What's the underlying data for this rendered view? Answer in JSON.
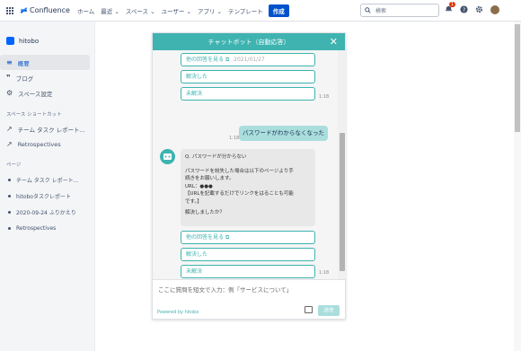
{
  "topbar": {
    "logo_text": "Confluence",
    "nav": [
      "ホーム",
      "最近 ⌄",
      "スペース ⌄",
      "ユーザー ⌄",
      "アプリ ⌄",
      "テンプレート"
    ],
    "create_label": "作成",
    "search_placeholder": "検索",
    "notification_count": "1"
  },
  "sidebar": {
    "space_name": "hitobo",
    "items": [
      {
        "label": "概要",
        "icon": "overview-icon"
      },
      {
        "label": "ブログ",
        "icon": "quote-icon"
      },
      {
        "label": "スペース設定",
        "icon": "gear-icon"
      }
    ],
    "shortcuts_title": "スペース ショートカット",
    "shortcuts": [
      "チーム タスク レポート...",
      "Retrospectives"
    ],
    "pages_title": "ページ",
    "pages": [
      "チーム タスク レポート...",
      "hitoboタスクレポート",
      "2020-09-24 ふりかえり",
      "Retrospectives"
    ]
  },
  "chat": {
    "title": "チャットボット（自動応答）",
    "top_options": [
      "他の回答を見る",
      "解決した",
      "未解決"
    ],
    "top_date": "2021/01/27",
    "time_top": "1:18",
    "user_message": "パスワードがわからなくなった",
    "time_user": "1:18",
    "bot_message": {
      "question": "Q. パスワードが分からない",
      "lines": [
        "パスワードを紛失した場合は以下のページより手",
        "続きをお願いします。",
        "URL：●●●",
        "【URLを記載するだけでリンクをはることも可能",
        "です。】",
        "",
        "解決しましたか？"
      ]
    },
    "bottom_options": [
      "他の回答を見る",
      "解決した",
      "未解決"
    ],
    "time_bottom": "1:18",
    "input_placeholder": "ここに質問を短文で入力：例「サービスについて」",
    "powered_by": "Powered by hitobo",
    "send_label": "送信"
  }
}
